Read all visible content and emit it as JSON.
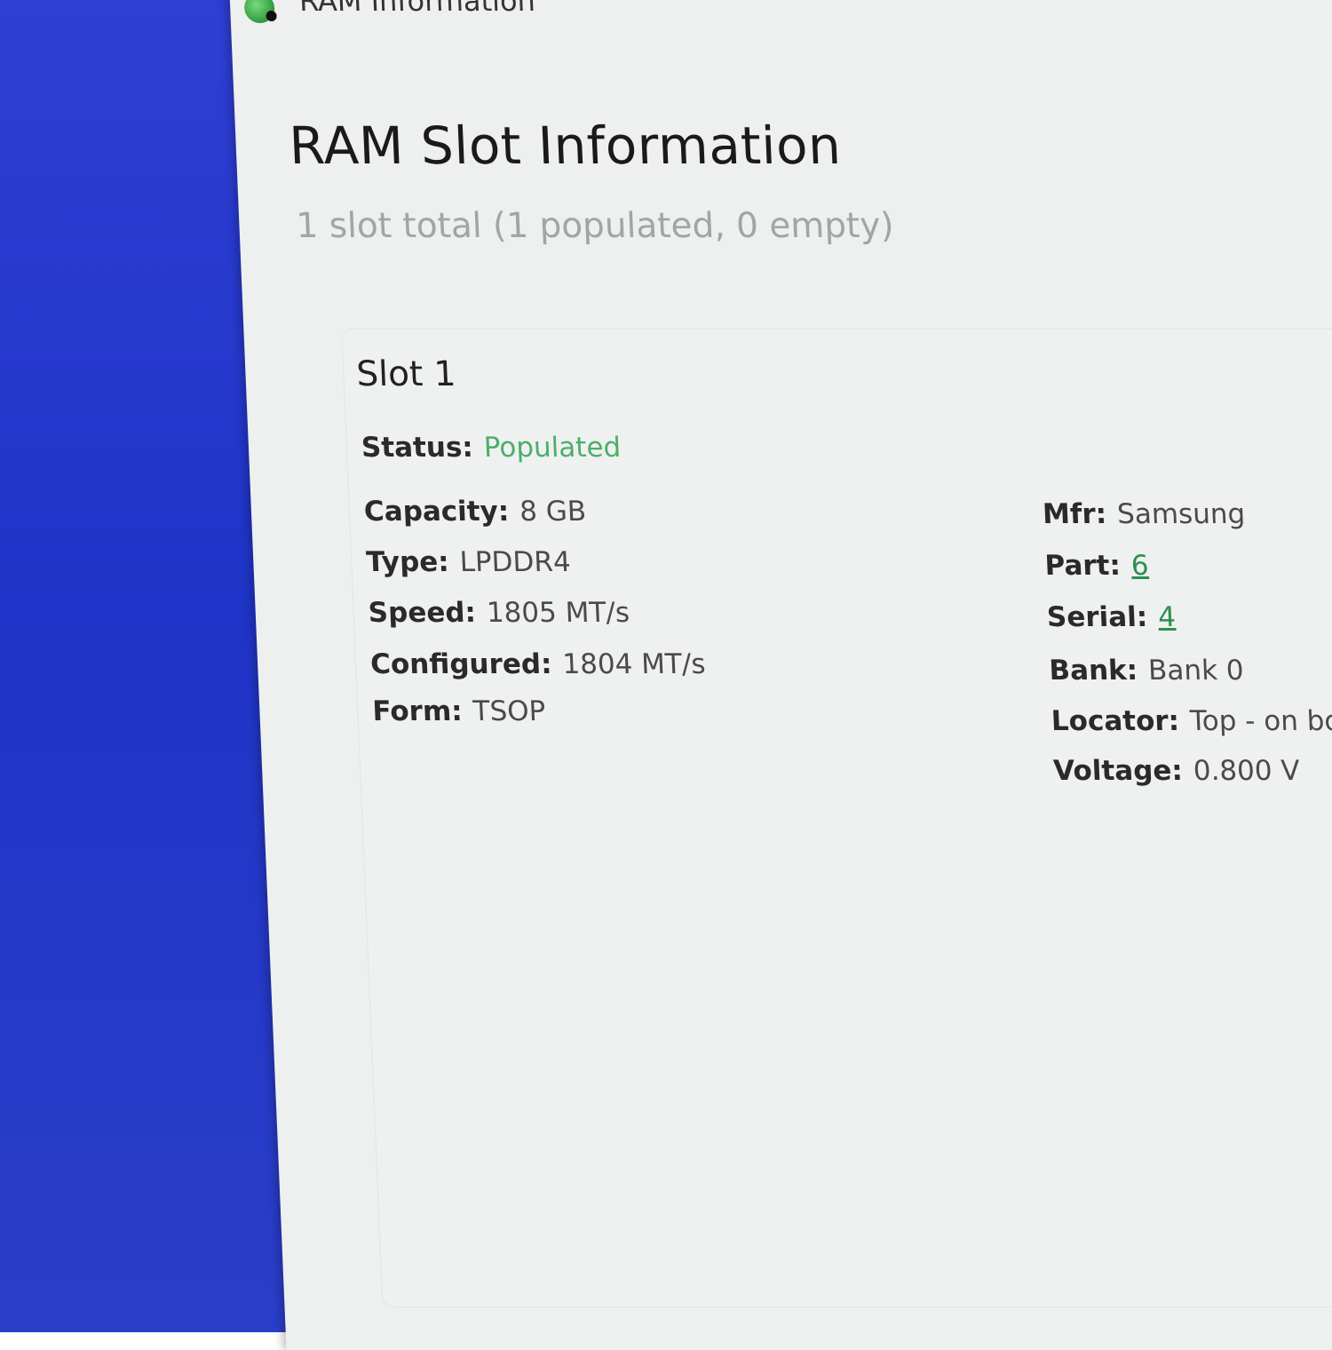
{
  "window": {
    "title": "RAM Information"
  },
  "page": {
    "title": "RAM Slot Information",
    "subtitle": "1 slot total (1 populated, 0 empty)"
  },
  "slot": {
    "title": "Slot 1",
    "status_label": "Status:",
    "status_value": "Populated",
    "left": [
      {
        "label": "Capacity:",
        "value": "8 GB"
      },
      {
        "label": "Type:",
        "value": "LPDDR4"
      },
      {
        "label": "Speed:",
        "value": "1805 MT/s"
      },
      {
        "label": "Configured:",
        "value": "1804 MT/s"
      },
      {
        "label": "Form:",
        "value": "TSOP"
      }
    ],
    "right": [
      {
        "label": "Mfr:",
        "value": "Samsung"
      },
      {
        "label": "Part:",
        "value": "6"
      },
      {
        "label": "Serial:",
        "value": "4"
      },
      {
        "label": "Bank:",
        "value": "Bank 0"
      },
      {
        "label": "Locator:",
        "value": "Top - on boar"
      },
      {
        "label": "Voltage:",
        "value": "0.800 V"
      }
    ]
  },
  "colors": {
    "desktop": "#2f3fd4",
    "window_bg": "#eef0ef",
    "status_green": "#4caf6a",
    "link_green": "#2e8f4f"
  },
  "icons": {
    "app": "ram-app-icon"
  }
}
